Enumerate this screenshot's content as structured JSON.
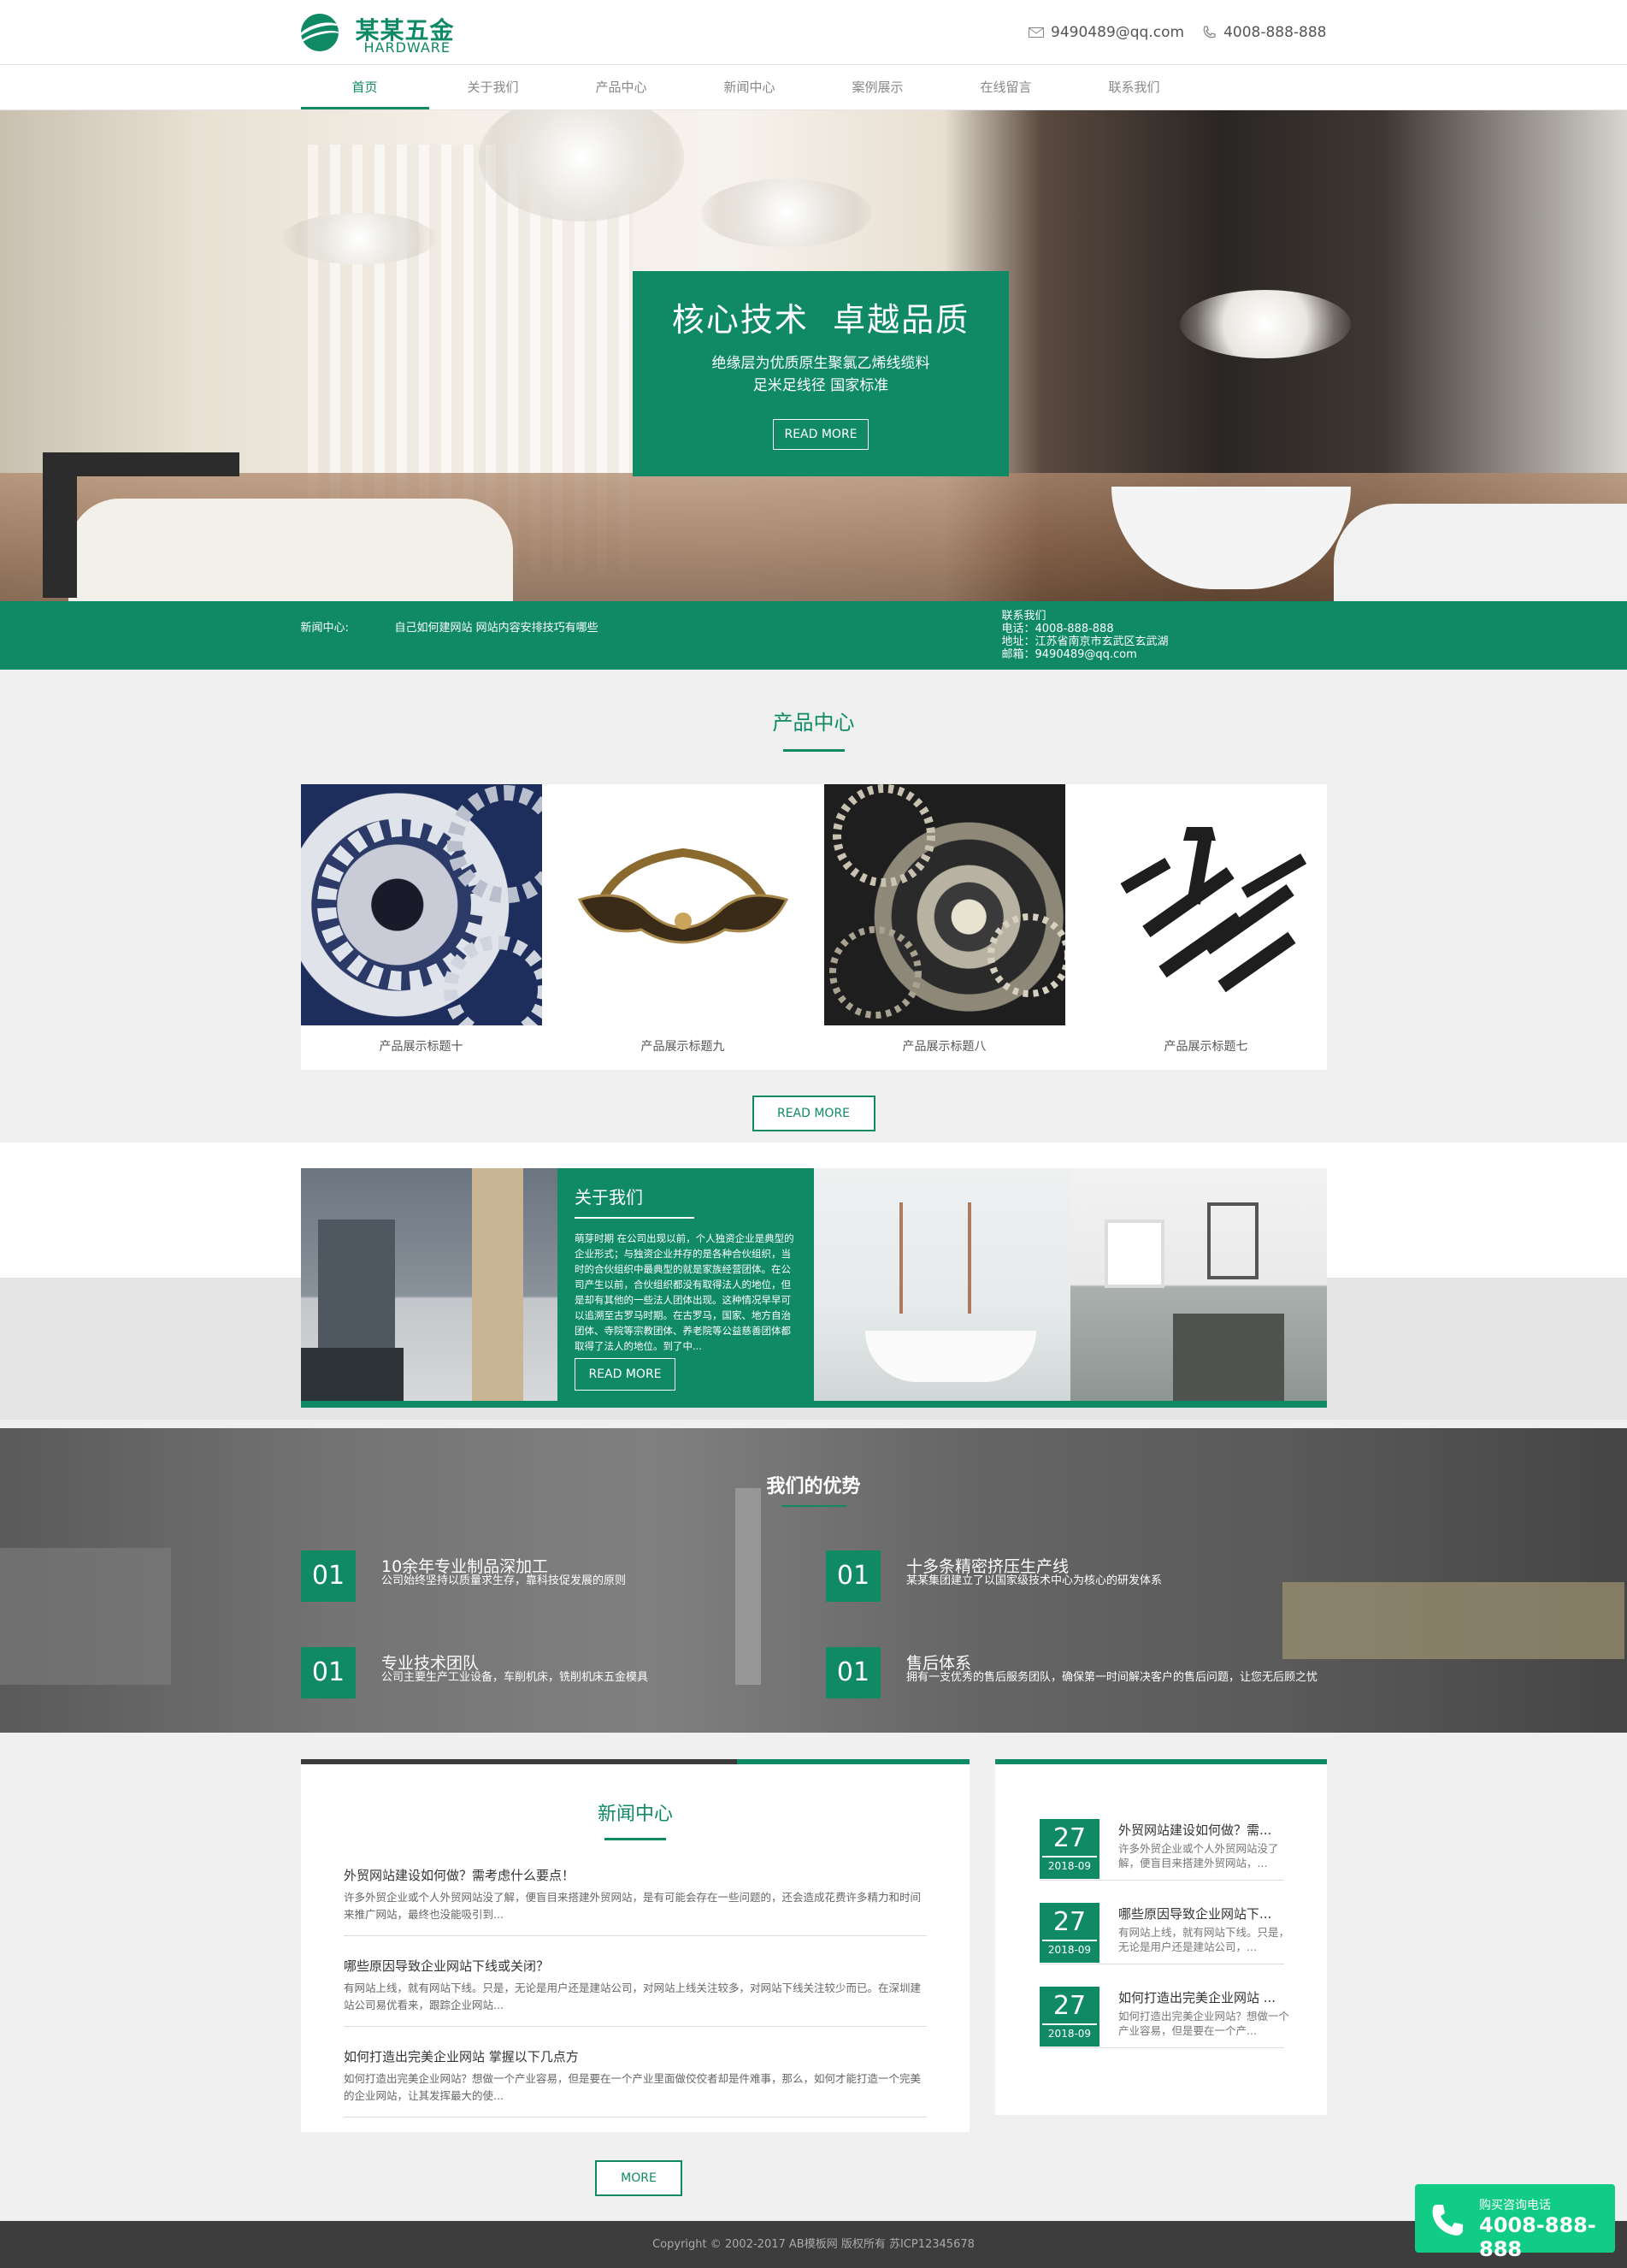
{
  "header": {
    "logo_cn": "某某五金",
    "logo_en": "HARDWARE",
    "email": "9490489@qq.com",
    "phone": "4008-888-888"
  },
  "nav": {
    "items": [
      {
        "label": "首页",
        "active": true
      },
      {
        "label": "关于我们"
      },
      {
        "label": "产品中心"
      },
      {
        "label": "新闻中心"
      },
      {
        "label": "案例展示"
      },
      {
        "label": "在线留言"
      },
      {
        "label": "联系我们"
      }
    ]
  },
  "banner": {
    "title": "核心技术  卓越品质",
    "line1": "绝缘层为优质原生聚氯乙烯线缆料",
    "line2": "足米足线径  国家标准",
    "button": "READ MORE"
  },
  "infobar": {
    "news_label": "新闻中心:",
    "news_text": "自己如何建网站 网站内容安排技巧有哪些",
    "contact_title": "联系我们",
    "contact_phone": "电话：4008-888-888",
    "contact_address": "地址：江苏省南京市玄武区玄武湖",
    "contact_email": "邮箱：9490489@qq.com"
  },
  "products": {
    "title": "产品中心",
    "items": [
      {
        "caption": "产品展示标题十"
      },
      {
        "caption": "产品展示标题九"
      },
      {
        "caption": "产品展示标题八"
      },
      {
        "caption": "产品展示标题七"
      }
    ],
    "button": "READ MORE"
  },
  "about": {
    "title": "关于我们",
    "text": "萌芽时期 在公司出现以前，个人独资企业是典型的企业形式；与独资企业并存的是各种合伙组织，当时的合伙组织中最典型的就是家族经营团体。在公司产生以前，合伙组织都没有取得法人的地位，但是却有其他的一些法人团体出现。这种情况早早可以追溯至古罗马时期。在古罗马，国家、地方自治团体、寺院等宗教团体、养老院等公益慈善团体都取得了法人的地位。到了中...",
    "button": "READ MORE"
  },
  "advantages": {
    "title": "我们的优势",
    "items": [
      {
        "num": "01",
        "title": "10余年专业制品深加工",
        "desc": "公司始终坚持以质量求生存，靠科技促发展的原则"
      },
      {
        "num": "01",
        "title": "十多条精密挤压生产线",
        "desc": "某某集团建立了以国家级技术中心为核心的研发体系"
      },
      {
        "num": "01",
        "title": "专业技术团队",
        "desc": "公司主要生产工业设备，车削机床，铣削机床五金模具"
      },
      {
        "num": "01",
        "title": "售后体系",
        "desc": "拥有一支优秀的售后服务团队，确保第一时间解决客户的售后问题，让您无后顾之忧"
      }
    ]
  },
  "news": {
    "title": "新闻中心",
    "list": [
      {
        "title": "外贸网站建设如何做？需考虑什么要点！",
        "desc": "许多外贸企业或个人外贸网站没了解，便盲目来搭建外贸网站，是有可能会存在一些问题的，还会造成花费许多精力和时间来推广网站，最终也没能吸引到..."
      },
      {
        "title": "哪些原因导致企业网站下线或关闭？",
        "desc": "有网站上线，就有网站下线。只是，无论是用户还是建站公司，对网站上线关注较多，对网站下线关注较少而已。在深圳建站公司易优看来，跟踪企业网站..."
      },
      {
        "title": "如何打造出完美企业网站 掌握以下几点方",
        "desc": "如何打造出完美企业网站？想做一个产业容易，但是要在一个产业里面做佼佼者却是件难事，那么，如何才能打造一个完美的企业网站，让其发挥最大的使..."
      }
    ],
    "side": [
      {
        "day": "27",
        "ym": "2018-09",
        "title": "外贸网站建设如何做？需...",
        "desc": "许多外贸企业或个人外贸网站没了解，便盲目来搭建外贸网站，..."
      },
      {
        "day": "27",
        "ym": "2018-09",
        "title": "哪些原因导致企业网站下...",
        "desc": "有网站上线，就有网站下线。只是，无论是用户还是建站公司，..."
      },
      {
        "day": "27",
        "ym": "2018-09",
        "title": "如何打造出完美企业网站 ...",
        "desc": "如何打造出完美企业网站？想做一个产业容易，但是要在一个产..."
      }
    ],
    "more": "MORE"
  },
  "footer": {
    "copyright": "Copyright © 2002-2017 AB模板网 版权所有 苏ICP12345678"
  },
  "float_call": {
    "label": "购买咨询电话",
    "number": "4008-888-888"
  },
  "colors": {
    "accent": "#0f8a65",
    "float": "#11cc84",
    "footer": "#3d3d3d"
  }
}
